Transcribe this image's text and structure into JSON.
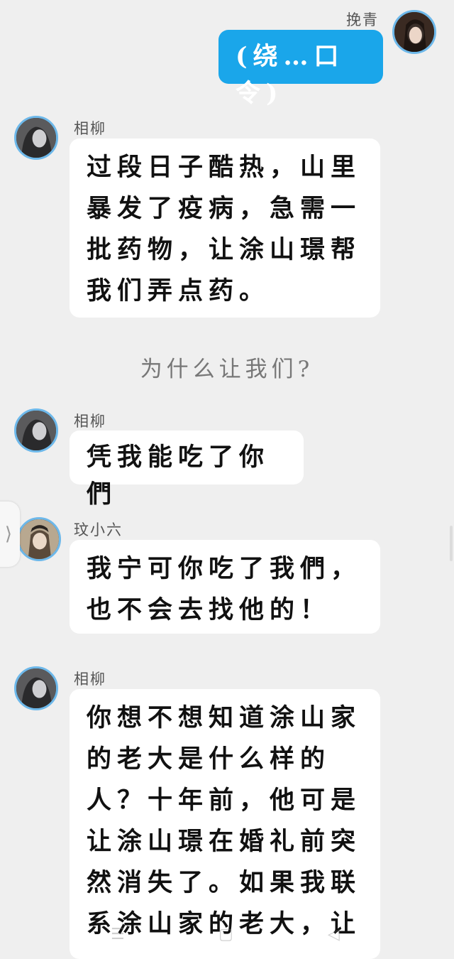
{
  "messages": [
    {
      "sender": "挽青",
      "text": "(绕…口令)",
      "side": "right"
    },
    {
      "sender": "相柳",
      "text": "过段日子酷热，山里暴发了疫病，急需一批药物，让涂山璟帮我们弄点药。",
      "side": "left"
    },
    {
      "narration": "为什么让我们?"
    },
    {
      "sender": "相柳",
      "text": "凭我能吃了你們",
      "side": "left"
    },
    {
      "sender": "玟小六",
      "text": "我宁可你吃了我們，也不会去找他的！",
      "side": "left"
    },
    {
      "sender": "相柳",
      "text": "你想不想知道涂山家的老大是什么样的人？十年前，他可是让涂山璟在婚礼前突然消失了。如果我联系涂山家的老大，让",
      "side": "left"
    }
  ],
  "ui": {
    "side_tab_icon": "chevron-right-icon",
    "side_tab_glyph": "⟩",
    "nav_menu_glyph": "☰",
    "nav_home_glyph": "▢",
    "nav_back_glyph": "◁"
  },
  "colors": {
    "background": "#efefef",
    "bubble_left": "#ffffff",
    "bubble_right": "#1aa6ea",
    "avatar_border": "#6db8ea"
  }
}
